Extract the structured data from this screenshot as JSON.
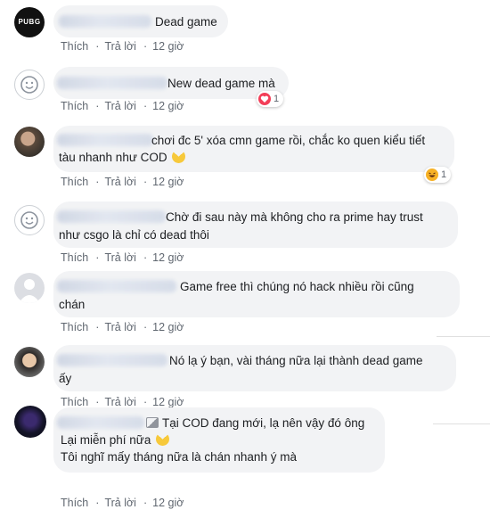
{
  "actions": {
    "like": "Thích",
    "reply": "Trả lời",
    "time": "12 giờ"
  },
  "comments": [
    {
      "lines": [
        "Dead game"
      ],
      "avatar": "PUBG"
    },
    {
      "lines": [
        "New dead game mà"
      ],
      "reaction_count": "1"
    },
    {
      "lines": [
        "chơi đc 5' xóa cmn game rồi, chắc ko quen kiểu tiết",
        "tàu nhanh như COD"
      ],
      "reaction_count": "1"
    },
    {
      "lines": [
        "Chờ đi sau này mà không cho ra prime hay trust",
        "như csgo là chỉ có dead thôi"
      ]
    },
    {
      "lines": [
        "Game free thì chúng nó hack nhiều rồi cũng",
        "chán"
      ]
    },
    {
      "lines": [
        "Nó lạ ý bạn, vài tháng nữa lại thành dead game",
        "ấy"
      ]
    },
    {
      "lines": [
        "Tại COD đang mới, lạ nên vậy đó ông",
        "Lại miễn phí nữa",
        "Tôi nghĩ mấy tháng nữa là chán nhanh ý mà"
      ]
    }
  ]
}
